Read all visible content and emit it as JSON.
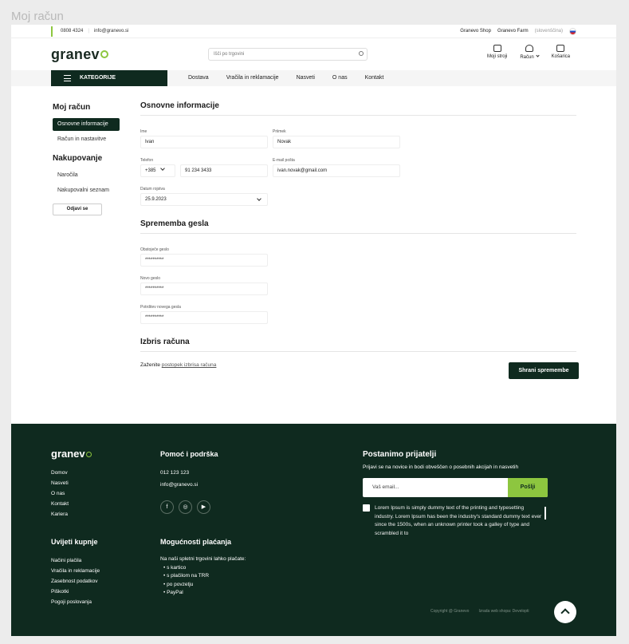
{
  "page_title": "Moj račun",
  "topbar": {
    "phone": "0808 4324",
    "email": "info@granevo.si",
    "shop": "Granevo Shop",
    "farm": "Granevo Farm",
    "lang": "(slovenščina)"
  },
  "header": {
    "logo": "granev",
    "search_placeholder": "Išči po trgovini",
    "machines": "Moji stroji",
    "account": "Račun",
    "cart": "Košarica"
  },
  "nav": {
    "categories": "KATEGORIJE",
    "links": [
      "Dostava",
      "Vračila in reklamacije",
      "Nasveti",
      "O nas",
      "Kontakt"
    ]
  },
  "sidebar": {
    "title": "Moj račun",
    "items": [
      "Osnovne informacije",
      "Račun in nastavitve"
    ],
    "shop_title": "Nakupovanje",
    "shop_items": [
      "Naročila",
      "Nakupovalni seznam"
    ],
    "logout": "Odjavi se"
  },
  "basic": {
    "title": "Osnovne informacije",
    "name_label": "Ime",
    "name": "Ivan",
    "surname_label": "Priimek",
    "surname": "Novak",
    "phone_label": "Telefon",
    "prefix": "+385",
    "phone": "91 234 3433",
    "email_label": "E-mail pošta",
    "email": "ivan.novak@gmail.com",
    "dob_label": "Datum rojstva",
    "dob": "25.9.2023"
  },
  "password": {
    "title": "Sprememba gesla",
    "current_label": "Obstoječe geslo",
    "current": "**********",
    "new_label": "Novo geslo",
    "new": "**********",
    "confirm_label": "Potrditev novega gesla",
    "confirm": "**********"
  },
  "delete": {
    "title": "Izbris računa",
    "text": "Zaženite",
    "link": "postopek izbrisa računa"
  },
  "save_button": "Shrani spremembe",
  "footer": {
    "logo": "granev",
    "col1": [
      "Domov",
      "Nasveti",
      "O nas",
      "Kontakt",
      "Kariera"
    ],
    "support_title": "Pomoć i podrška",
    "support_phone": "012 123 123",
    "support_email": "info@granevo.si",
    "buyers_title": "Uvijeti kupnje",
    "col_buyers": [
      "Načini plačila",
      "Vračila in reklamacije",
      "Zasebnost podatkov",
      "Piškotki",
      "Pogoji poslovanja"
    ],
    "pay_title": "Mogućnosti plaćanja",
    "pay_intro": "Na naši spletni trgovini lahko plačate:",
    "pay_items": [
      "s kartico",
      "s plačilom na TRR",
      "po povzetju",
      "PayPal"
    ],
    "news_title": "Postanimo prijatelji",
    "news_text": "Prijavi se na novice in bodi obveščen o posebnih akcijah in nasvetih",
    "email_placeholder": "Vaš email...",
    "subscribe": "Pošlji",
    "lorem": "Lorem Ipsum is simply dummy text of the printing and typesetting industry. Lorem Ipsum has been the industry's standard dummy text ever since the 1500s, when an unknown printer took a galley of type and scrambled it to",
    "copyright": "Copyright @ Granevo",
    "credits": "Izrada web shopa: Developti"
  }
}
